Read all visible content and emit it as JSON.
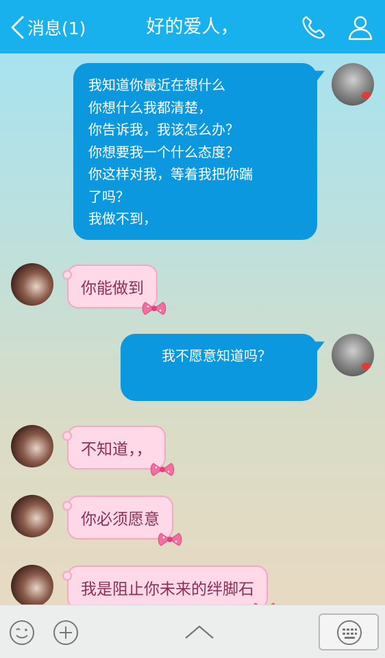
{
  "header": {
    "back_label": "消息(1)",
    "title": "好的爱人，",
    "icons": [
      "chevron-left-icon",
      "phone-icon",
      "contact-icon"
    ]
  },
  "messages": [
    {
      "side": "out",
      "lines": [
        "  我知道你最近在想什么",
        "  你想什么我都清楚，",
        "  你告诉我，我该怎么办？",
        "  你想要我一个什么态度？",
        "  你这样对我，等着我把你踹",
        "了吗？",
        "  我做不到，"
      ]
    },
    {
      "side": "in",
      "text": "你能做到"
    },
    {
      "side": "out",
      "lines": [
        "  我不愿意知道吗？"
      ]
    },
    {
      "side": "in",
      "text": "不知道，，"
    },
    {
      "side": "in",
      "text": "你必须愿意"
    },
    {
      "side": "in",
      "text": "我是阻止你未来的绊脚石"
    }
  ],
  "toolbar": {
    "icons": [
      "emoji-icon",
      "plus-icon",
      "chevron-up-icon",
      "keyboard-icon"
    ]
  },
  "colors": {
    "header": "#19b0ee",
    "outgoing_bubble": "#0c98df",
    "incoming_bubble": "#ffd9e8",
    "incoming_text": "#8f2d55"
  }
}
